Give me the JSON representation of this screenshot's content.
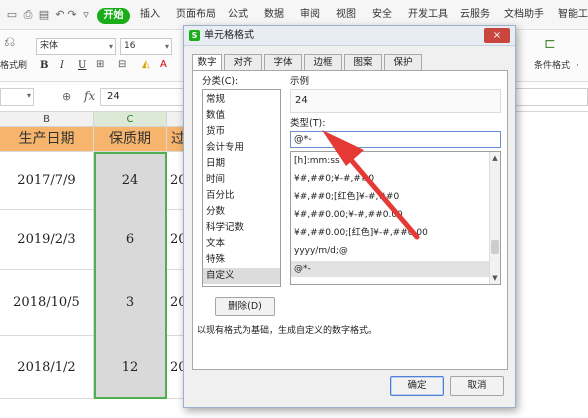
{
  "menubar": {
    "start_tab": "开始",
    "tabs": [
      "插入",
      "页面布局",
      "公式",
      "数据",
      "审阅",
      "视图",
      "安全",
      "开发工具",
      "云服务",
      "文档助手",
      "智能工"
    ]
  },
  "ribbon": {
    "format_painter": "格式刷",
    "font_name": "宋体",
    "font_size": "16",
    "bold": "B",
    "italic": "I",
    "underline": "U",
    "conditional_format": "条件格式",
    "conditional_format_more": "·"
  },
  "formula_bar": {
    "fx": "fx",
    "value": "24"
  },
  "sheet": {
    "columns": [
      "B",
      "C",
      ""
    ],
    "header_row": [
      "生产日期",
      "保质期",
      "过"
    ],
    "rows": [
      {
        "b": "2017/7/9",
        "c": "24",
        "d": "20"
      },
      {
        "b": "2019/2/3",
        "c": "6",
        "d": "20"
      },
      {
        "b": "2018/10/5",
        "c": "3",
        "d": "20"
      },
      {
        "b": "2018/1/2",
        "c": "12",
        "d": "20"
      }
    ]
  },
  "dialog": {
    "title": "单元格格式",
    "close": "×",
    "tabs": [
      "数字",
      "对齐",
      "字体",
      "边框",
      "图案",
      "保护"
    ],
    "category_label": "分类(C):",
    "categories": [
      "常规",
      "数值",
      "货币",
      "会计专用",
      "日期",
      "时间",
      "百分比",
      "分数",
      "科学记数",
      "文本",
      "特殊",
      "自定义"
    ],
    "sample_label": "示例",
    "sample_value": "24",
    "type_label": "类型(T):",
    "type_value": "@*-",
    "formats": [
      "[h]:mm:ss",
      "¥#,##0;¥-#,##0",
      "¥#,##0;[红色]¥-#,##0",
      "¥#,##0.00;¥-#,##0.00",
      "¥#,##0.00;[红色]¥-#,##0.00",
      "yyyy/m/d;@",
      "@*-"
    ],
    "delete_button": "删除(D)",
    "description": "以现有格式为基础，生成自定义的数字格式。",
    "ok_button": "确定",
    "cancel_button": "取消"
  },
  "colors": {
    "accent_green": "#1aad19",
    "header_orange": "#f6b46c",
    "selection_border": "#4caf50",
    "arrow_red": "#e53935",
    "close_red": "#c9463d"
  }
}
